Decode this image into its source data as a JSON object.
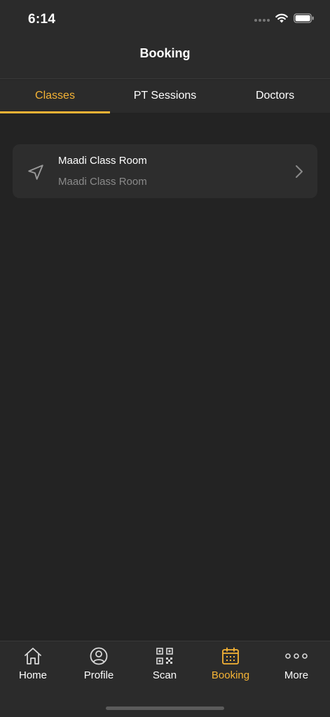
{
  "status_bar": {
    "time": "6:14"
  },
  "header": {
    "title": "Booking"
  },
  "tabs": [
    {
      "label": "Classes",
      "active": true
    },
    {
      "label": "PT Sessions",
      "active": false
    },
    {
      "label": "Doctors",
      "active": false
    }
  ],
  "locations": [
    {
      "title": "Maadi Class Room",
      "subtitle": "Maadi Class Room",
      "icon": "navigation-arrow-icon"
    }
  ],
  "bottom_nav": [
    {
      "label": "Home",
      "icon": "home-icon",
      "active": false
    },
    {
      "label": "Profile",
      "icon": "profile-icon",
      "active": false
    },
    {
      "label": "Scan",
      "icon": "qr-code-icon",
      "active": false
    },
    {
      "label": "Booking",
      "icon": "calendar-icon",
      "active": true
    },
    {
      "label": "More",
      "icon": "more-dots-icon",
      "active": false
    }
  ],
  "colors": {
    "accent": "#f5b335",
    "background": "#232323",
    "bar": "#2b2b2b",
    "card": "#2d2d2d",
    "muted_text": "#8a8a8a"
  }
}
